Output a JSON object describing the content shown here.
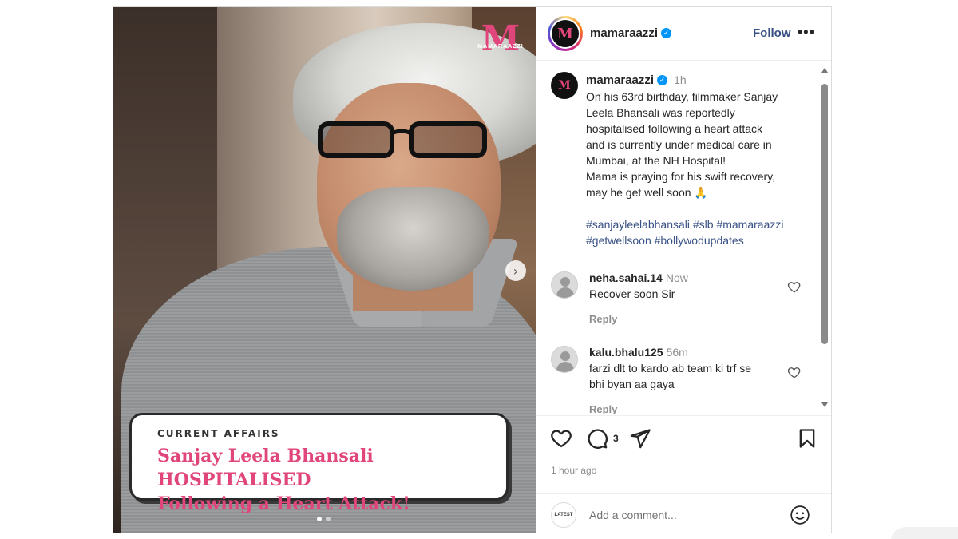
{
  "media": {
    "brand_mark": "M",
    "brand_small": "MAMARAAZZI",
    "caption_kicker": "CURRENT AFFAIRS",
    "caption_title_line1": "Sanjay Leela Bhansali HOSPITALISED",
    "caption_title_line2": "Following a Heart Attack!",
    "next_glyph": "›",
    "carousel": {
      "count": 2,
      "active": 1
    }
  },
  "header": {
    "avatar_mark": "M",
    "username": "mamaraazzi",
    "follow_label": "Follow",
    "more_glyph": "•••"
  },
  "caption": {
    "avatar_mark": "M",
    "username": "mamaraazzi",
    "time": "1h",
    "text": "On his 63rd birthday, filmmaker Sanjay\nLeela Bhansali was reportedly\nhospitalised following a heart attack\nand is currently under medical care in\nMumbai, at the NH Hospital!\nMama is praying for his swift recovery,\nmay he get well soon 🙏",
    "hashtags": "#sanjayleelabhansali #slb #mamaraazzi\n#getwellsoon #bollywodupdates"
  },
  "comments": [
    {
      "username": "neha.sahai.14",
      "time": "Now",
      "text": "Recover soon Sir",
      "reply_label": "Reply"
    },
    {
      "username": "kalu.bhalu125",
      "time": "56m",
      "text": "farzi dlt to kardo ab team ki trf se\nbhi byan aa gaya",
      "reply_label": "Reply"
    }
  ],
  "actions": {
    "comment_count": "3",
    "time_ago": "1 hour ago"
  },
  "add_comment": {
    "avatar_text": "LATEST",
    "placeholder": "Add a comment..."
  },
  "colors": {
    "brand_pink": "#e0457b",
    "link_blue": "#385185",
    "verified_blue": "#0095f6",
    "muted": "#8e8e8e"
  }
}
